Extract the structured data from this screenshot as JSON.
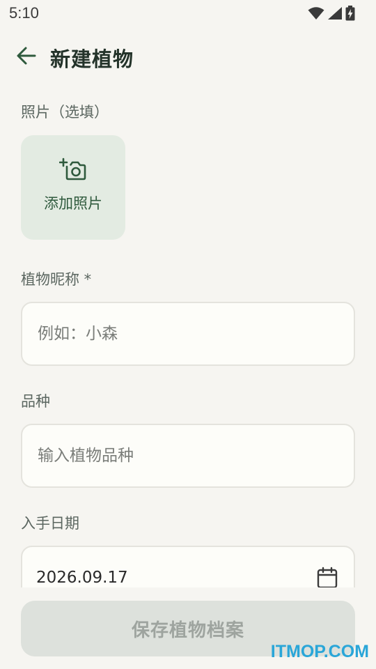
{
  "status_bar": {
    "time": "5:10",
    "icons": [
      "wifi-icon",
      "signal-icon",
      "battery-charging-icon"
    ]
  },
  "app_bar": {
    "back_icon": "arrow-left-icon",
    "title": "新建植物"
  },
  "photo": {
    "label": "照片（选填）",
    "add_text": "添加照片",
    "icon": "add-photo-icon"
  },
  "nickname": {
    "label": "植物昵称 *",
    "value": "",
    "placeholder": "例如：小森"
  },
  "species": {
    "label": "品种",
    "value": "",
    "placeholder": "输入植物品种"
  },
  "acquired_date": {
    "label": "入手日期",
    "value": "2026.09.17",
    "icon": "calendar-icon"
  },
  "save_button": {
    "label": "保存植物档案",
    "enabled": false
  },
  "watermark": "ITMOP.COM",
  "colors": {
    "background": "#f6f5f1",
    "primary": "#2f5a3d",
    "photo_tile": "#e3ebe2",
    "disabled_button": "#dde1dc",
    "watermark": "#2aa6d8"
  }
}
